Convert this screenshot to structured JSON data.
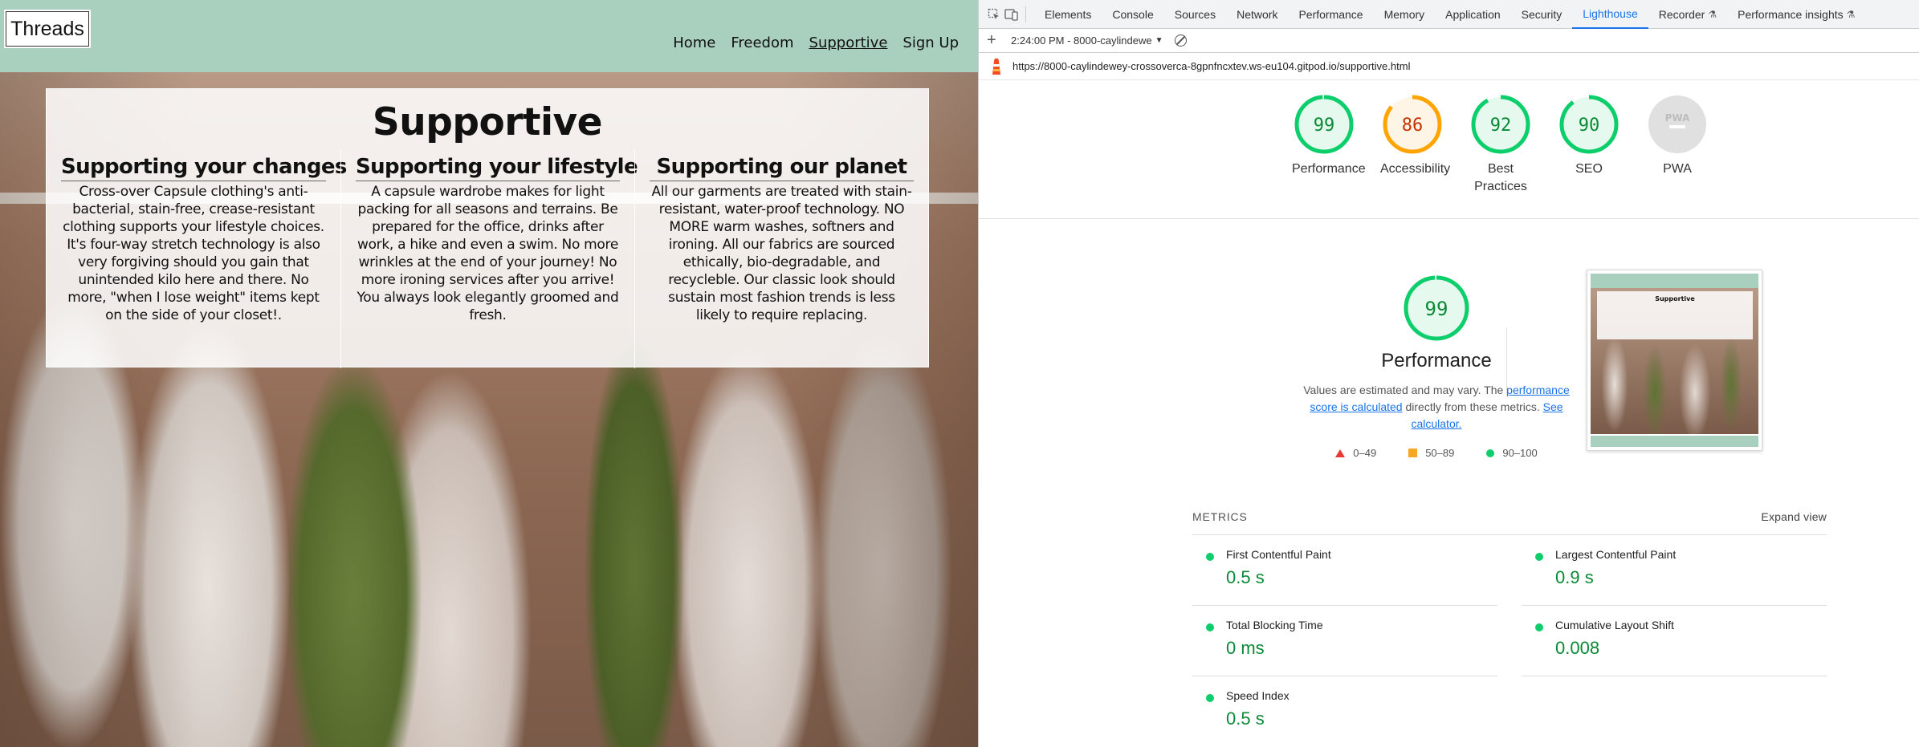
{
  "site": {
    "logo": "Threads",
    "nav": [
      {
        "label": "Home"
      },
      {
        "label": "Freedom"
      },
      {
        "label": "Supportive",
        "active": true
      },
      {
        "label": "Sign Up"
      }
    ],
    "heading": "Supportive",
    "columns": [
      {
        "title": "Supporting your changes",
        "text": "Cross-over Capsule clothing's anti-bacterial, stain-free, crease-resistant clothing supports your lifestyle choices. It's four-way stretch technology is also very forgiving should you gain that unintended kilo here and there. No more, \"when I lose weight\" items kept on the side of your closet!."
      },
      {
        "title": "Supporting your lifestyle",
        "text": "A capsule wardrobe makes for light packing for all seasons and terrains. Be prepared for the office, drinks after work, a hike and even a swim. No more wrinkles at the end of your journey! No more ironing services after you arrive! You always look elegantly groomed and fresh."
      },
      {
        "title": "Supporting our planet",
        "text": "All our garments are treated with stain-resistant, water-proof technology. NO MORE warm washes, softners and ironing. All our fabrics are sourced ethically, bio-degradable, and recycleble. Our classic look should sustain most fashion trends is less likely to require replacing."
      }
    ],
    "colors": {
      "header": "#a9cfbf"
    }
  },
  "devtools": {
    "tabs": [
      "Elements",
      "Console",
      "Sources",
      "Network",
      "Performance",
      "Memory",
      "Application",
      "Security",
      "Lighthouse",
      "Recorder",
      "Performance insights"
    ],
    "active_tab": "Lighthouse",
    "report_selector": "2:24:00 PM - 8000-caylindewe",
    "url": "https://8000-caylindewey-crossoverca-8gpnfncxtev.ws-eu104.gitpod.io/supportive.html",
    "gauges": [
      {
        "score": "99",
        "label": "Performance",
        "status": "pass"
      },
      {
        "score": "86",
        "label": "Accessibility",
        "status": "average"
      },
      {
        "score": "92",
        "label": "Best Practices",
        "status": "pass"
      },
      {
        "score": "90",
        "label": "SEO",
        "status": "pass"
      },
      {
        "score": "PWA",
        "label": "PWA",
        "status": "na"
      }
    ],
    "performance": {
      "score": "99",
      "title": "Performance",
      "desc_prefix": "Values are estimated and may vary. The ",
      "desc_link1": "performance score is calculated",
      "desc_middle": " directly from these metrics. ",
      "desc_link2": "See calculator.",
      "legend": [
        "0–49",
        "50–89",
        "90–100"
      ]
    },
    "thumbnail_heading": "Supportive",
    "metrics": {
      "heading": "METRICS",
      "expand": "Expand view",
      "items": [
        {
          "name": "First Contentful Paint",
          "value": "0.5 s"
        },
        {
          "name": "Largest Contentful Paint",
          "value": "0.9 s"
        },
        {
          "name": "Total Blocking Time",
          "value": "0 ms"
        },
        {
          "name": "Cumulative Layout Shift",
          "value": "0.008"
        },
        {
          "name": "Speed Index",
          "value": "0.5 s"
        }
      ]
    },
    "colors": {
      "pass": "#0cce6b",
      "average": "#ffa400",
      "fail": "#ff4e42",
      "accent": "#1a73e8"
    }
  }
}
